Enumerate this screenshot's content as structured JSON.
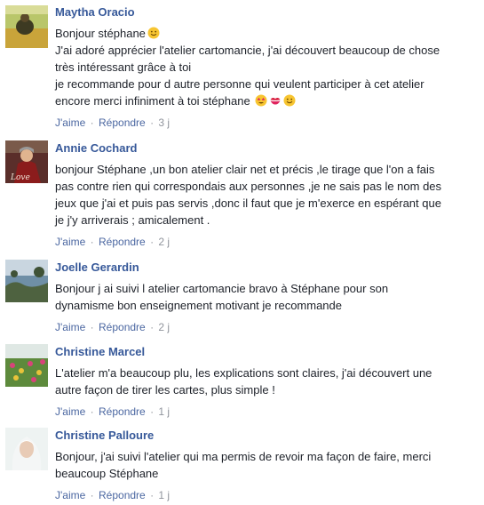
{
  "actions": {
    "like": "J'aime",
    "reply": "Répondre",
    "dot": "·"
  },
  "comments": [
    {
      "author": "Maytha Oracio",
      "lines": [
        "Bonjour stéphane",
        "J'ai adoré apprécier l'atelier cartomancie, j'ai découvert beaucoup de chose",
        "très intéressant grâce à toi",
        "je recommande pour d autre personne qui veulent participer à cet atelier",
        "encore merci infiniment à toi stéphane"
      ],
      "time": "3 j",
      "avatar_colors": {
        "sky": "#b9c66a",
        "ground": "#c9a43a",
        "figure": "#3d3a22"
      }
    },
    {
      "author": "Annie Cochard",
      "lines": [
        "bonjour Stéphane ,un bon atelier clair net et précis ,le tirage que l'on a fais",
        "pas contre rien qui correspondais aux personnes ,je ne sais pas le nom des",
        "jeux que j'ai et puis pas servis ,donc il faut que je m'exerce en espérant que",
        "je j'y arriverais ; amicalement ."
      ],
      "time": "2 j",
      "avatar_text": "Love",
      "avatar_colors": {
        "bg": "#5a2e2a",
        "coat": "#8b1c1c",
        "face": "#e1b48f"
      }
    },
    {
      "author": "Joelle Gerardin",
      "lines": [
        "Bonjour j ai suivi l atelier cartomancie bravo à Stéphane pour son",
        "dynamisme bon enseignement motivant je recommande"
      ],
      "time": "2 j",
      "avatar_colors": {
        "sky": "#c9d6e0",
        "sea": "#6f8fa6",
        "land": "#4e6240"
      }
    },
    {
      "author": "Christine Marcel",
      "lines": [
        "L'atelier m'a beaucoup plu, les explications sont claires, j'ai découvert une",
        "autre façon de tirer les cartes, plus simple !"
      ],
      "time": "1 j",
      "avatar_colors": {
        "sky": "#dfe8e4",
        "field": "#5d8a3c",
        "flower1": "#d9437a",
        "flower2": "#e8c33a"
      }
    },
    {
      "author": "Christine Palloure",
      "lines": [
        "Bonjour, j'ai suivi l'atelier qui ma permis de revoir ma façon de faire, merci",
        "beaucoup Stéphane"
      ],
      "time": "1 j",
      "avatar_colors": {
        "bg": "#eef3f2",
        "hair": "#f4f6f6",
        "face": "#e8cbb6"
      }
    }
  ],
  "emojis": {
    "smile": "smiling-face-emoji",
    "star_struck": "star-struck-emoji",
    "kiss": "kiss-mark-emoji"
  }
}
